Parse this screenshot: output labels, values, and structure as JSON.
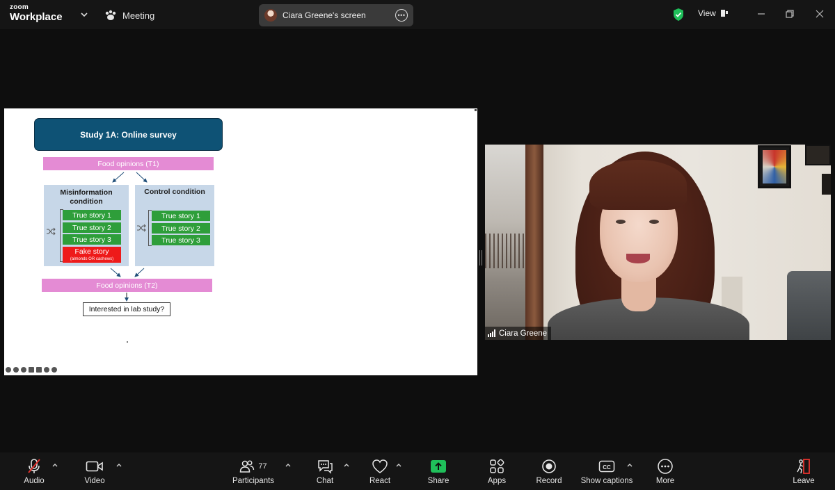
{
  "app": {
    "logo_top": "zoom",
    "logo_bottom": "Workplace",
    "meeting_label": "Meeting",
    "share_label": "Ciara Greene's screen",
    "view_label": "View"
  },
  "slide": {
    "title": "Study 1A: Online survey",
    "food_t1": "Food opinions (T1)",
    "food_t2": "Food opinions (T2)",
    "misinfo_title": "Misinformation condition",
    "control_title": "Control condition",
    "misinfo_items": [
      "True story 1",
      "True story 2",
      "True story 3"
    ],
    "control_items": [
      "True story 1",
      "True story 2",
      "True story 3"
    ],
    "fake_story": "Fake story",
    "fake_story_sub": "(almonds OR cashews)",
    "lab_question": "Interested in lab study?"
  },
  "video": {
    "participant_name": "Ciara Greene"
  },
  "toolbar": {
    "audio": "Audio",
    "video": "Video",
    "participants": "Participants",
    "participants_count": "77",
    "chat": "Chat",
    "react": "React",
    "share": "Share",
    "apps": "Apps",
    "record": "Record",
    "captions": "Show captions",
    "more": "More",
    "leave": "Leave"
  },
  "colors": {
    "slide_title_bg": "#0e5275",
    "pink_box": "#e48bd4",
    "panel_bg": "#c7d7e8",
    "green_box": "#2e9e3a",
    "red_box": "#ee1a1a",
    "share_green": "#1fbf5a",
    "leave_red": "#e5322d"
  }
}
